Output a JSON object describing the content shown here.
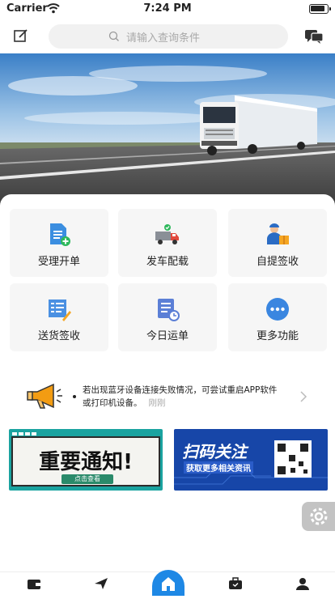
{
  "status_bar": {
    "carrier": "Carrier",
    "time": "7:24 PM"
  },
  "search": {
    "placeholder": "请输入查询条件"
  },
  "menu": [
    {
      "label": "受理开单",
      "icon": "document-plus-icon"
    },
    {
      "label": "发车配载",
      "icon": "truck-icon"
    },
    {
      "label": "自提签收",
      "icon": "person-box-icon"
    },
    {
      "label": "送货签收",
      "icon": "list-pen-icon"
    },
    {
      "label": "今日运单",
      "icon": "waybill-clock-icon"
    },
    {
      "label": "更多功能",
      "icon": "more-dots-icon"
    }
  ],
  "notice": {
    "text": "若出现蓝牙设备连接失败情况，可尝试重启APP软件或打印机设备。",
    "time": "刚刚"
  },
  "promo_cards": [
    {
      "title": "重要通知!",
      "button": "点击查看"
    },
    {
      "title": "扫码关注",
      "subtitle": "获取更多相关资讯"
    }
  ],
  "colors": {
    "accent": "#1e88e5",
    "tile_bg": "#f6f6f6",
    "notice_orange": "#f39c12"
  }
}
